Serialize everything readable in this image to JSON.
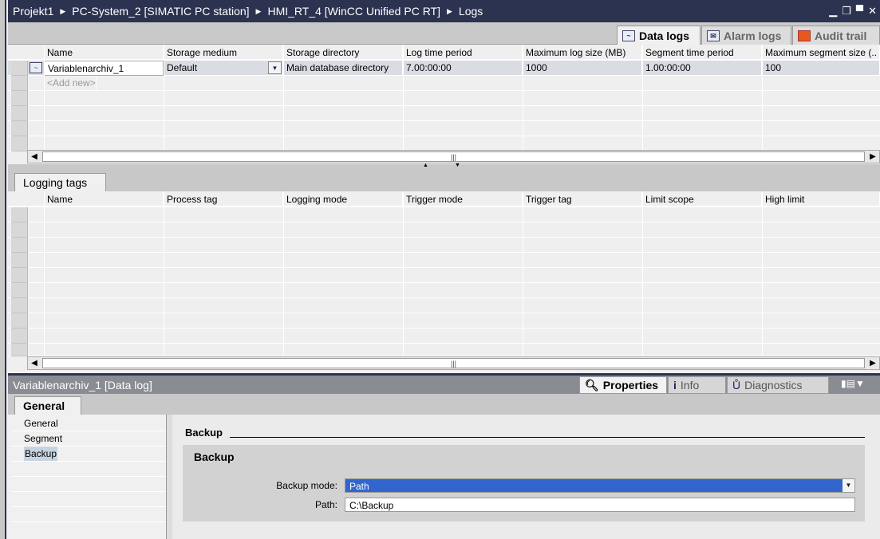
{
  "breadcrumb": [
    "Projekt1",
    "PC-System_2 [SIMATIC PC station]",
    "HMI_RT_4 [WinCC Unified PC RT]",
    "Logs"
  ],
  "editor_tabs": [
    {
      "label": "Data logs",
      "icon": "data-log-icon",
      "active": true
    },
    {
      "label": "Alarm logs",
      "icon": "alarm-log-icon",
      "active": false
    },
    {
      "label": "Audit trail",
      "icon": "audit-trail-icon",
      "active": false
    }
  ],
  "data_logs": {
    "columns": [
      "Name",
      "Storage medium",
      "Storage directory",
      "Log time period",
      "Maximum log size (MB)",
      "Segment time period",
      "Maximum segment size (.."
    ],
    "rows": [
      [
        "Variablenarchiv_1",
        "Default",
        "Main database directory",
        "7.00:00:00",
        "1000",
        "1.00:00:00",
        "100"
      ]
    ],
    "add_new": "<Add new>"
  },
  "logging_tags": {
    "tab": "Logging tags",
    "columns": [
      "Name",
      "Process tag",
      "Logging mode",
      "Trigger mode",
      "Trigger tag",
      "Limit scope",
      "High limit"
    ]
  },
  "inspector": {
    "title": "Variablenarchiv_1 [Data log]",
    "tabs": [
      "Properties",
      "Info",
      "Diagnostics"
    ],
    "general_tab": "General",
    "nav": [
      "General",
      "Segment",
      "Backup"
    ],
    "selected_nav": "Backup",
    "section_title": "Backup",
    "group_title": "Backup",
    "backup_mode_label": "Backup mode:",
    "backup_mode_value": "Path",
    "path_label": "Path:",
    "path_value": "C:\\Backup"
  },
  "colors": {
    "titlebar": "#2c3350",
    "selection": "#3366cc"
  }
}
